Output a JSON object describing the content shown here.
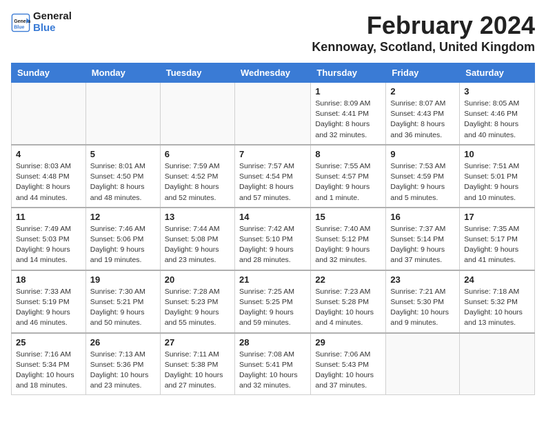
{
  "app": {
    "logo_line1": "General",
    "logo_line2": "Blue"
  },
  "header": {
    "month": "February 2024",
    "location": "Kennoway, Scotland, United Kingdom"
  },
  "weekdays": [
    "Sunday",
    "Monday",
    "Tuesday",
    "Wednesday",
    "Thursday",
    "Friday",
    "Saturday"
  ],
  "weeks": [
    [
      {
        "day": "",
        "detail": ""
      },
      {
        "day": "",
        "detail": ""
      },
      {
        "day": "",
        "detail": ""
      },
      {
        "day": "",
        "detail": ""
      },
      {
        "day": "1",
        "detail": "Sunrise: 8:09 AM\nSunset: 4:41 PM\nDaylight: 8 hours\nand 32 minutes."
      },
      {
        "day": "2",
        "detail": "Sunrise: 8:07 AM\nSunset: 4:43 PM\nDaylight: 8 hours\nand 36 minutes."
      },
      {
        "day": "3",
        "detail": "Sunrise: 8:05 AM\nSunset: 4:46 PM\nDaylight: 8 hours\nand 40 minutes."
      }
    ],
    [
      {
        "day": "4",
        "detail": "Sunrise: 8:03 AM\nSunset: 4:48 PM\nDaylight: 8 hours\nand 44 minutes."
      },
      {
        "day": "5",
        "detail": "Sunrise: 8:01 AM\nSunset: 4:50 PM\nDaylight: 8 hours\nand 48 minutes."
      },
      {
        "day": "6",
        "detail": "Sunrise: 7:59 AM\nSunset: 4:52 PM\nDaylight: 8 hours\nand 52 minutes."
      },
      {
        "day": "7",
        "detail": "Sunrise: 7:57 AM\nSunset: 4:54 PM\nDaylight: 8 hours\nand 57 minutes."
      },
      {
        "day": "8",
        "detail": "Sunrise: 7:55 AM\nSunset: 4:57 PM\nDaylight: 9 hours\nand 1 minute."
      },
      {
        "day": "9",
        "detail": "Sunrise: 7:53 AM\nSunset: 4:59 PM\nDaylight: 9 hours\nand 5 minutes."
      },
      {
        "day": "10",
        "detail": "Sunrise: 7:51 AM\nSunset: 5:01 PM\nDaylight: 9 hours\nand 10 minutes."
      }
    ],
    [
      {
        "day": "11",
        "detail": "Sunrise: 7:49 AM\nSunset: 5:03 PM\nDaylight: 9 hours\nand 14 minutes."
      },
      {
        "day": "12",
        "detail": "Sunrise: 7:46 AM\nSunset: 5:06 PM\nDaylight: 9 hours\nand 19 minutes."
      },
      {
        "day": "13",
        "detail": "Sunrise: 7:44 AM\nSunset: 5:08 PM\nDaylight: 9 hours\nand 23 minutes."
      },
      {
        "day": "14",
        "detail": "Sunrise: 7:42 AM\nSunset: 5:10 PM\nDaylight: 9 hours\nand 28 minutes."
      },
      {
        "day": "15",
        "detail": "Sunrise: 7:40 AM\nSunset: 5:12 PM\nDaylight: 9 hours\nand 32 minutes."
      },
      {
        "day": "16",
        "detail": "Sunrise: 7:37 AM\nSunset: 5:14 PM\nDaylight: 9 hours\nand 37 minutes."
      },
      {
        "day": "17",
        "detail": "Sunrise: 7:35 AM\nSunset: 5:17 PM\nDaylight: 9 hours\nand 41 minutes."
      }
    ],
    [
      {
        "day": "18",
        "detail": "Sunrise: 7:33 AM\nSunset: 5:19 PM\nDaylight: 9 hours\nand 46 minutes."
      },
      {
        "day": "19",
        "detail": "Sunrise: 7:30 AM\nSunset: 5:21 PM\nDaylight: 9 hours\nand 50 minutes."
      },
      {
        "day": "20",
        "detail": "Sunrise: 7:28 AM\nSunset: 5:23 PM\nDaylight: 9 hours\nand 55 minutes."
      },
      {
        "day": "21",
        "detail": "Sunrise: 7:25 AM\nSunset: 5:25 PM\nDaylight: 9 hours\nand 59 minutes."
      },
      {
        "day": "22",
        "detail": "Sunrise: 7:23 AM\nSunset: 5:28 PM\nDaylight: 10 hours\nand 4 minutes."
      },
      {
        "day": "23",
        "detail": "Sunrise: 7:21 AM\nSunset: 5:30 PM\nDaylight: 10 hours\nand 9 minutes."
      },
      {
        "day": "24",
        "detail": "Sunrise: 7:18 AM\nSunset: 5:32 PM\nDaylight: 10 hours\nand 13 minutes."
      }
    ],
    [
      {
        "day": "25",
        "detail": "Sunrise: 7:16 AM\nSunset: 5:34 PM\nDaylight: 10 hours\nand 18 minutes."
      },
      {
        "day": "26",
        "detail": "Sunrise: 7:13 AM\nSunset: 5:36 PM\nDaylight: 10 hours\nand 23 minutes."
      },
      {
        "day": "27",
        "detail": "Sunrise: 7:11 AM\nSunset: 5:38 PM\nDaylight: 10 hours\nand 27 minutes."
      },
      {
        "day": "28",
        "detail": "Sunrise: 7:08 AM\nSunset: 5:41 PM\nDaylight: 10 hours\nand 32 minutes."
      },
      {
        "day": "29",
        "detail": "Sunrise: 7:06 AM\nSunset: 5:43 PM\nDaylight: 10 hours\nand 37 minutes."
      },
      {
        "day": "",
        "detail": ""
      },
      {
        "day": "",
        "detail": ""
      }
    ]
  ]
}
